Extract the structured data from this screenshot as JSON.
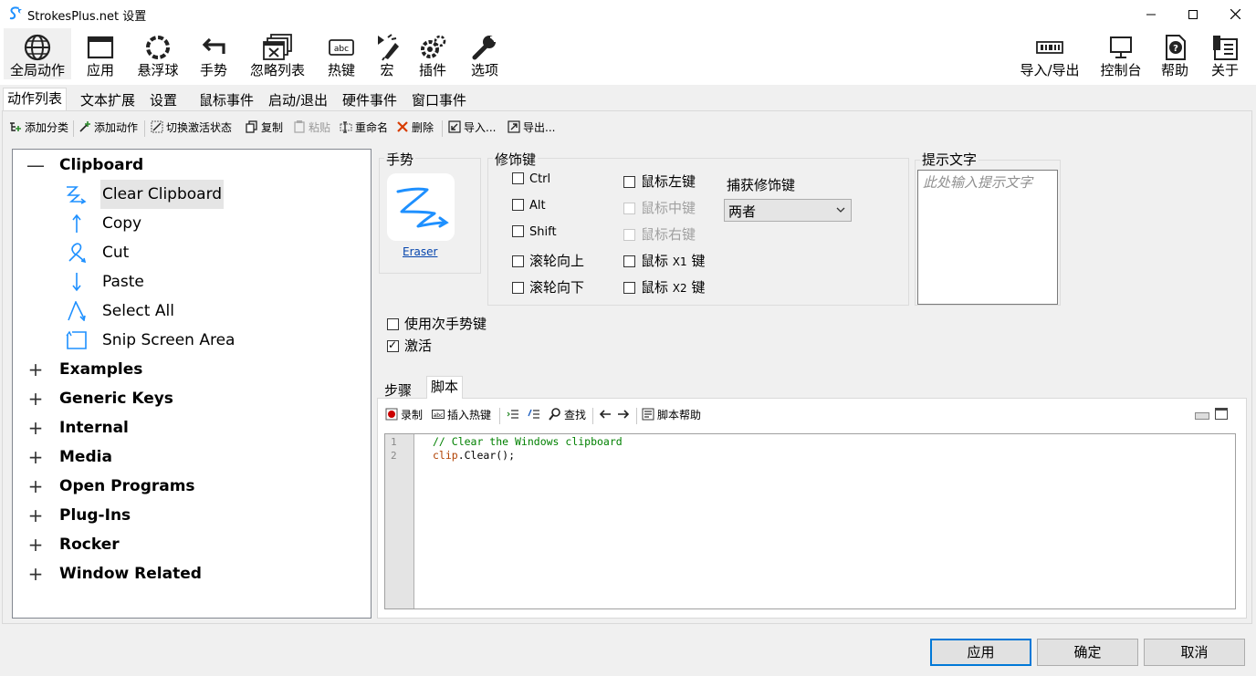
{
  "window": {
    "title": "StrokesPlus.net 设置",
    "controls": [
      "minimize",
      "maximize",
      "close"
    ]
  },
  "toolbar": {
    "left": [
      {
        "label": "全局动作",
        "icon": "globe-icon"
      },
      {
        "label": "应用",
        "icon": "window-icon"
      },
      {
        "label": "悬浮球",
        "icon": "ring-icon"
      },
      {
        "label": "手势",
        "icon": "gesture-icon"
      },
      {
        "label": "忽略列表",
        "icon": "ignore-list-icon"
      },
      {
        "label": "热键",
        "icon": "hotkey-icon"
      },
      {
        "label": "宏",
        "icon": "macro-icon"
      },
      {
        "label": "插件",
        "icon": "plugin-icon"
      },
      {
        "label": "选项",
        "icon": "wrench-icon"
      }
    ],
    "right": [
      {
        "label": "导入/导出",
        "icon": "import-export-icon"
      },
      {
        "label": "控制台",
        "icon": "console-icon"
      },
      {
        "label": "帮助",
        "icon": "help-icon"
      },
      {
        "label": "关于",
        "icon": "about-icon"
      }
    ]
  },
  "tabs": [
    "动作列表",
    "文本扩展",
    "设置",
    "鼠标事件",
    "启动/退出",
    "硬件事件",
    "窗口事件"
  ],
  "action_toolbar": {
    "add_category": "添加分类",
    "add_action": "添加动作",
    "toggle_active": "切换激活状态",
    "copy": "复制",
    "paste": "粘贴",
    "rename": "重命名",
    "delete": "删除",
    "import": "导入...",
    "export": "导出..."
  },
  "tree": {
    "expanded": {
      "label": "Clipboard",
      "children": [
        "Clear Clipboard",
        "Copy",
        "Cut",
        "Paste",
        "Select All",
        "Snip Screen Area"
      ]
    },
    "collapsed": [
      "Examples",
      "Generic Keys",
      "Internal",
      "Media",
      "Open Programs",
      "Plug-Ins",
      "Rocker",
      "Window Related"
    ],
    "toggle_expanded": "—",
    "toggle_collapsed": "+"
  },
  "gesture": {
    "title": "手势",
    "name": "Eraser"
  },
  "modifiers": {
    "title": "修饰键",
    "ctrl": "Ctrl",
    "alt": "Alt",
    "shift": "Shift",
    "wheel_up": "滚轮向上",
    "wheel_down": "滚轮向下",
    "mouse_left": "鼠标左键",
    "mouse_middle": "鼠标中键",
    "mouse_right": "鼠标右键",
    "mouse_x1_a": "鼠标",
    "mouse_x1_b": "X1",
    "mouse_x1_c": "键",
    "mouse_x2_a": "鼠标",
    "mouse_x2_b": "X2",
    "mouse_x2_c": "键",
    "capture_title": "捕获修饰键",
    "capture_value": "两者"
  },
  "hint": {
    "title": "提示文字",
    "placeholder": "此处输入提示文字"
  },
  "options": {
    "secondary_key": "使用次手势键",
    "active": "激活"
  },
  "subtabs": [
    "步骤",
    "脚本"
  ],
  "script_toolbar": {
    "record": "录制",
    "insert_hotkey": "插入热键",
    "find": "查找",
    "script_help": "脚本帮助"
  },
  "script": {
    "line_numbers": [
      "1",
      "2"
    ],
    "line1": "// Clear the Windows clipboard",
    "line2_obj": "clip",
    "line2_rest": ".Clear();"
  },
  "buttons": {
    "apply": "应用",
    "ok": "确定",
    "cancel": "取消"
  },
  "colors": {
    "accent": "#0078d7",
    "gesture_blue": "#1e90ff",
    "comment_green": "#008000",
    "delete_red": "#d83b01",
    "record_red": "#cc0000"
  }
}
